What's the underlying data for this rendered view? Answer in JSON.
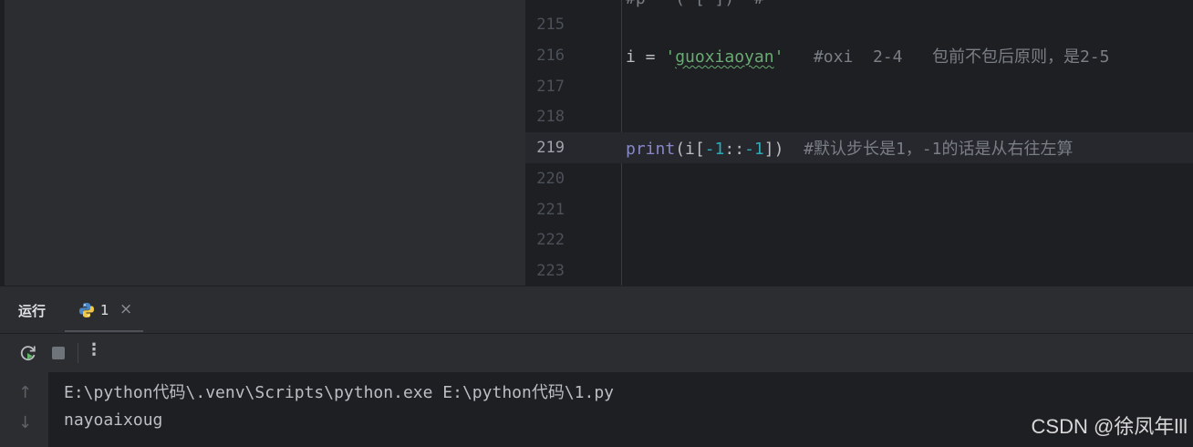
{
  "editor": {
    "partial_top": "#p   ( [ ])  #  ",
    "lines": [
      {
        "num": "215"
      },
      {
        "num": "216"
      },
      {
        "num": "217"
      },
      {
        "num": "218"
      },
      {
        "num": "219"
      },
      {
        "num": "220"
      },
      {
        "num": "221"
      },
      {
        "num": "222"
      },
      {
        "num": "223"
      }
    ],
    "line216": {
      "var": "i",
      "eq": " = ",
      "q_open": "'",
      "str": "guoxiaoyan",
      "q_close": "'",
      "comment": "   #oxi  2-4   包前不包后原则，是2-5"
    },
    "line219": {
      "func": "print",
      "p1": "(i[",
      "n1": "-1",
      "p2": "::",
      "n2": "-1",
      "p3": "])",
      "comment": "  #默认步长是1，-1的话是从右往左算"
    }
  },
  "run_panel": {
    "title": "运行",
    "tab_label": "1",
    "tab_close": "×",
    "more": "⋮",
    "output": [
      "E:\\python代码\\.venv\\Scripts\\python.exe E:\\python代码\\1.py",
      "nayoaixoug"
    ],
    "arrow_up": "↑",
    "arrow_down": "↓"
  },
  "watermark": "CSDN @徐凤年lll",
  "colors": {
    "bg": "#1e1f22",
    "panel": "#2b2d30",
    "string": "#6aab73",
    "comment": "#7a7e85",
    "number": "#2aacb8",
    "builtin": "#8888c6",
    "run_green": "#5fb865"
  },
  "icons": {
    "rerun": "rerun-icon",
    "stop": "stop-icon",
    "python": "python-icon"
  }
}
